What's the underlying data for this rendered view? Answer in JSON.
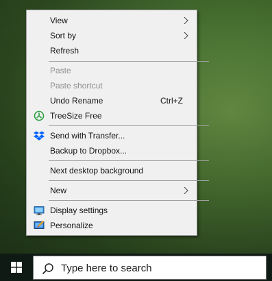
{
  "context_menu": {
    "view": "View",
    "sort_by": "Sort by",
    "refresh": "Refresh",
    "paste": "Paste",
    "paste_shortcut": "Paste shortcut",
    "undo_rename": "Undo Rename",
    "undo_shortcut": "Ctrl+Z",
    "treesize_free": "TreeSize Free",
    "send_with_transfer": "Send with Transfer...",
    "backup_to_dropbox": "Backup to Dropbox...",
    "next_desktop_background": "Next desktop background",
    "new": "New",
    "display_settings": "Display settings",
    "personalize": "Personalize"
  },
  "taskbar": {
    "search_placeholder": "Type here to search"
  },
  "colors": {
    "menu_background": "#f0f0f0",
    "disabled_text": "#8d8d8d",
    "taskbar_background": "#101a14",
    "treesize_green": "#2ea043",
    "dropbox_blue": "#0061fe"
  }
}
